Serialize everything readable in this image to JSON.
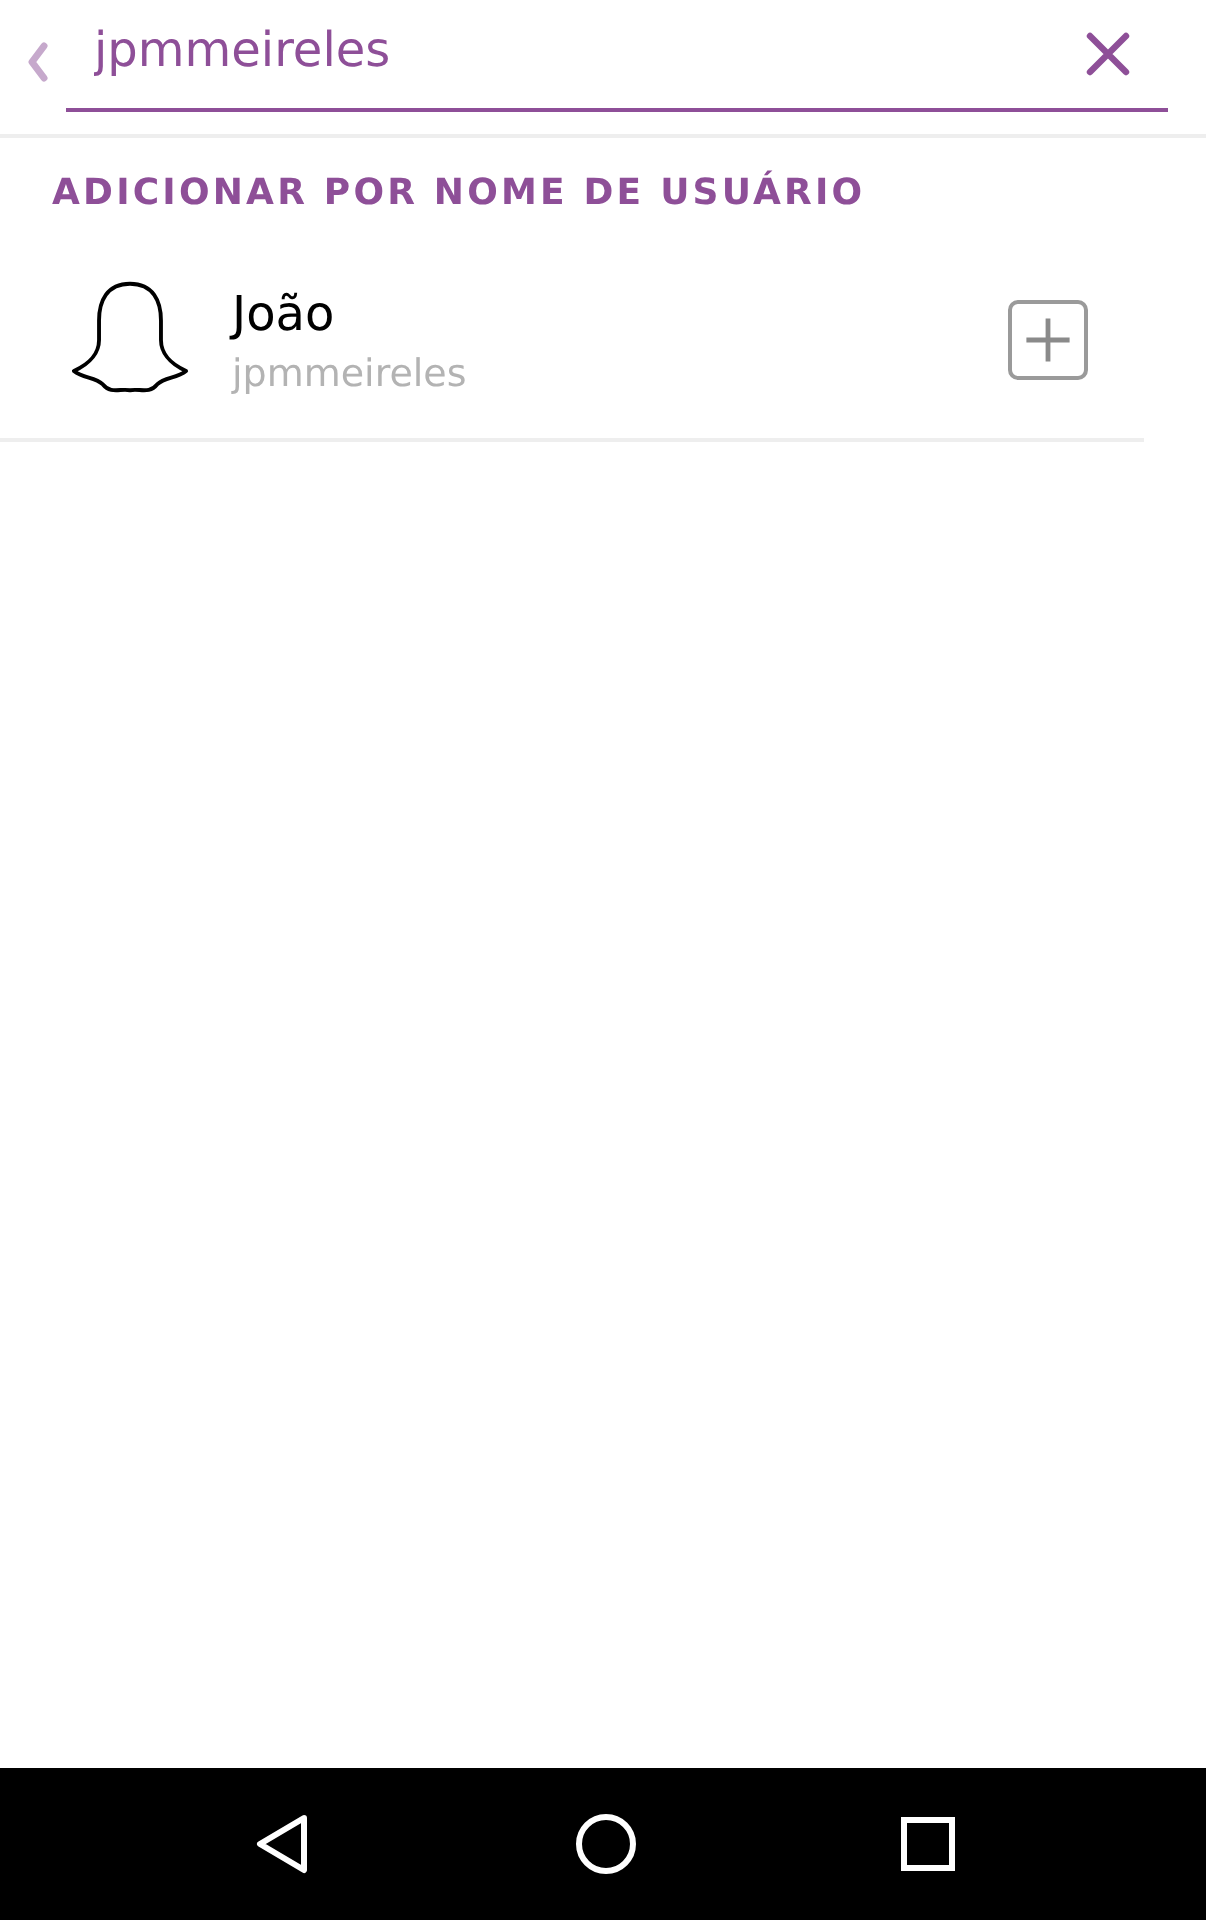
{
  "search": {
    "value": "jpmmeireles"
  },
  "section_title": "ADICIONAR POR NOME DE USUÁRIO",
  "results": [
    {
      "name": "João",
      "username": "jpmmeireles",
      "added": false
    }
  ]
}
